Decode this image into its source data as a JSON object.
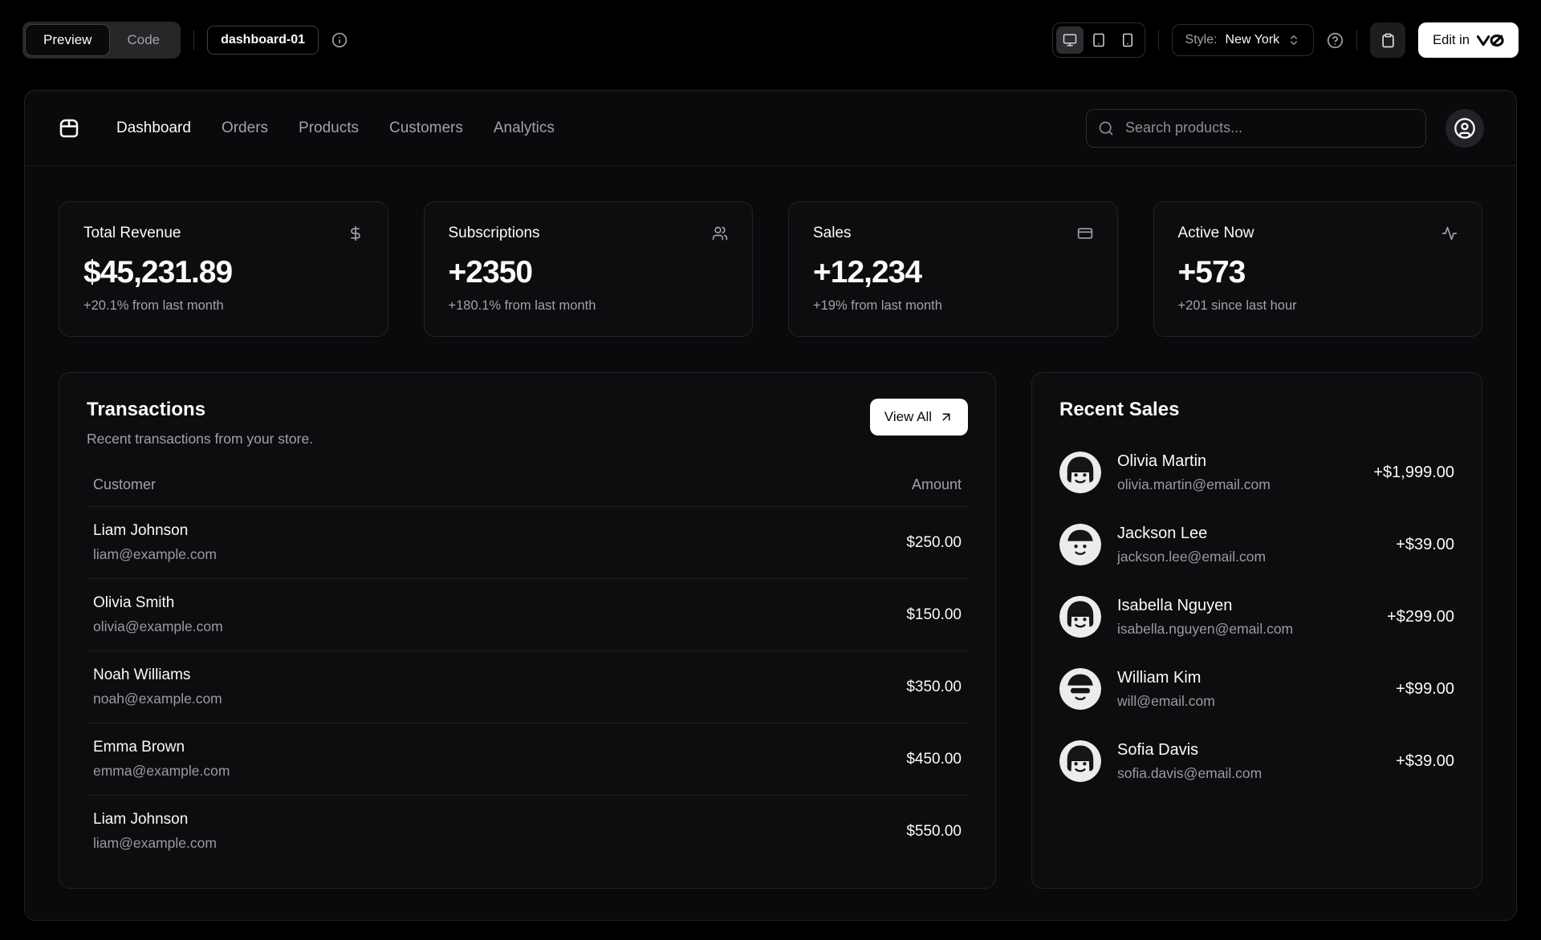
{
  "toolbar": {
    "preview_tab": "Preview",
    "code_tab": "Code",
    "block_badge": "dashboard-01",
    "style_label": "Style:",
    "style_value": "New York",
    "edit_label": "Edit in"
  },
  "nav": {
    "links": [
      {
        "label": "Dashboard",
        "active": true
      },
      {
        "label": "Orders",
        "active": false
      },
      {
        "label": "Products",
        "active": false
      },
      {
        "label": "Customers",
        "active": false
      },
      {
        "label": "Analytics",
        "active": false
      }
    ],
    "search_placeholder": "Search products..."
  },
  "stats": [
    {
      "title": "Total Revenue",
      "value": "$45,231.89",
      "change": "+20.1% from last month",
      "icon": "dollar-sign-icon"
    },
    {
      "title": "Subscriptions",
      "value": "+2350",
      "change": "+180.1% from last month",
      "icon": "users-icon"
    },
    {
      "title": "Sales",
      "value": "+12,234",
      "change": "+19% from last month",
      "icon": "credit-card-icon"
    },
    {
      "title": "Active Now",
      "value": "+573",
      "change": "+201 since last hour",
      "icon": "activity-icon"
    }
  ],
  "transactions": {
    "title": "Transactions",
    "subtitle": "Recent transactions from your store.",
    "view_all_label": "View All",
    "columns": {
      "customer": "Customer",
      "amount": "Amount"
    },
    "rows": [
      {
        "name": "Liam Johnson",
        "email": "liam@example.com",
        "amount": "$250.00"
      },
      {
        "name": "Olivia Smith",
        "email": "olivia@example.com",
        "amount": "$150.00"
      },
      {
        "name": "Noah Williams",
        "email": "noah@example.com",
        "amount": "$350.00"
      },
      {
        "name": "Emma Brown",
        "email": "emma@example.com",
        "amount": "$450.00"
      },
      {
        "name": "Liam Johnson",
        "email": "liam@example.com",
        "amount": "$550.00"
      }
    ]
  },
  "recent_sales": {
    "title": "Recent Sales",
    "items": [
      {
        "name": "Olivia Martin",
        "email": "olivia.martin@email.com",
        "amount": "+$1,999.00"
      },
      {
        "name": "Jackson Lee",
        "email": "jackson.lee@email.com",
        "amount": "+$39.00"
      },
      {
        "name": "Isabella Nguyen",
        "email": "isabella.nguyen@email.com",
        "amount": "+$299.00"
      },
      {
        "name": "William Kim",
        "email": "will@email.com",
        "amount": "+$99.00"
      },
      {
        "name": "Sofia Davis",
        "email": "sofia.davis@email.com",
        "amount": "+$39.00"
      }
    ]
  },
  "colors": {
    "background": "#000000",
    "panel": "#0a0a0c",
    "card": "#0d0d0f",
    "border": "#232327",
    "text": "#fafafa",
    "muted_text": "#a1a1aa",
    "accent_button": "#ffffff"
  }
}
